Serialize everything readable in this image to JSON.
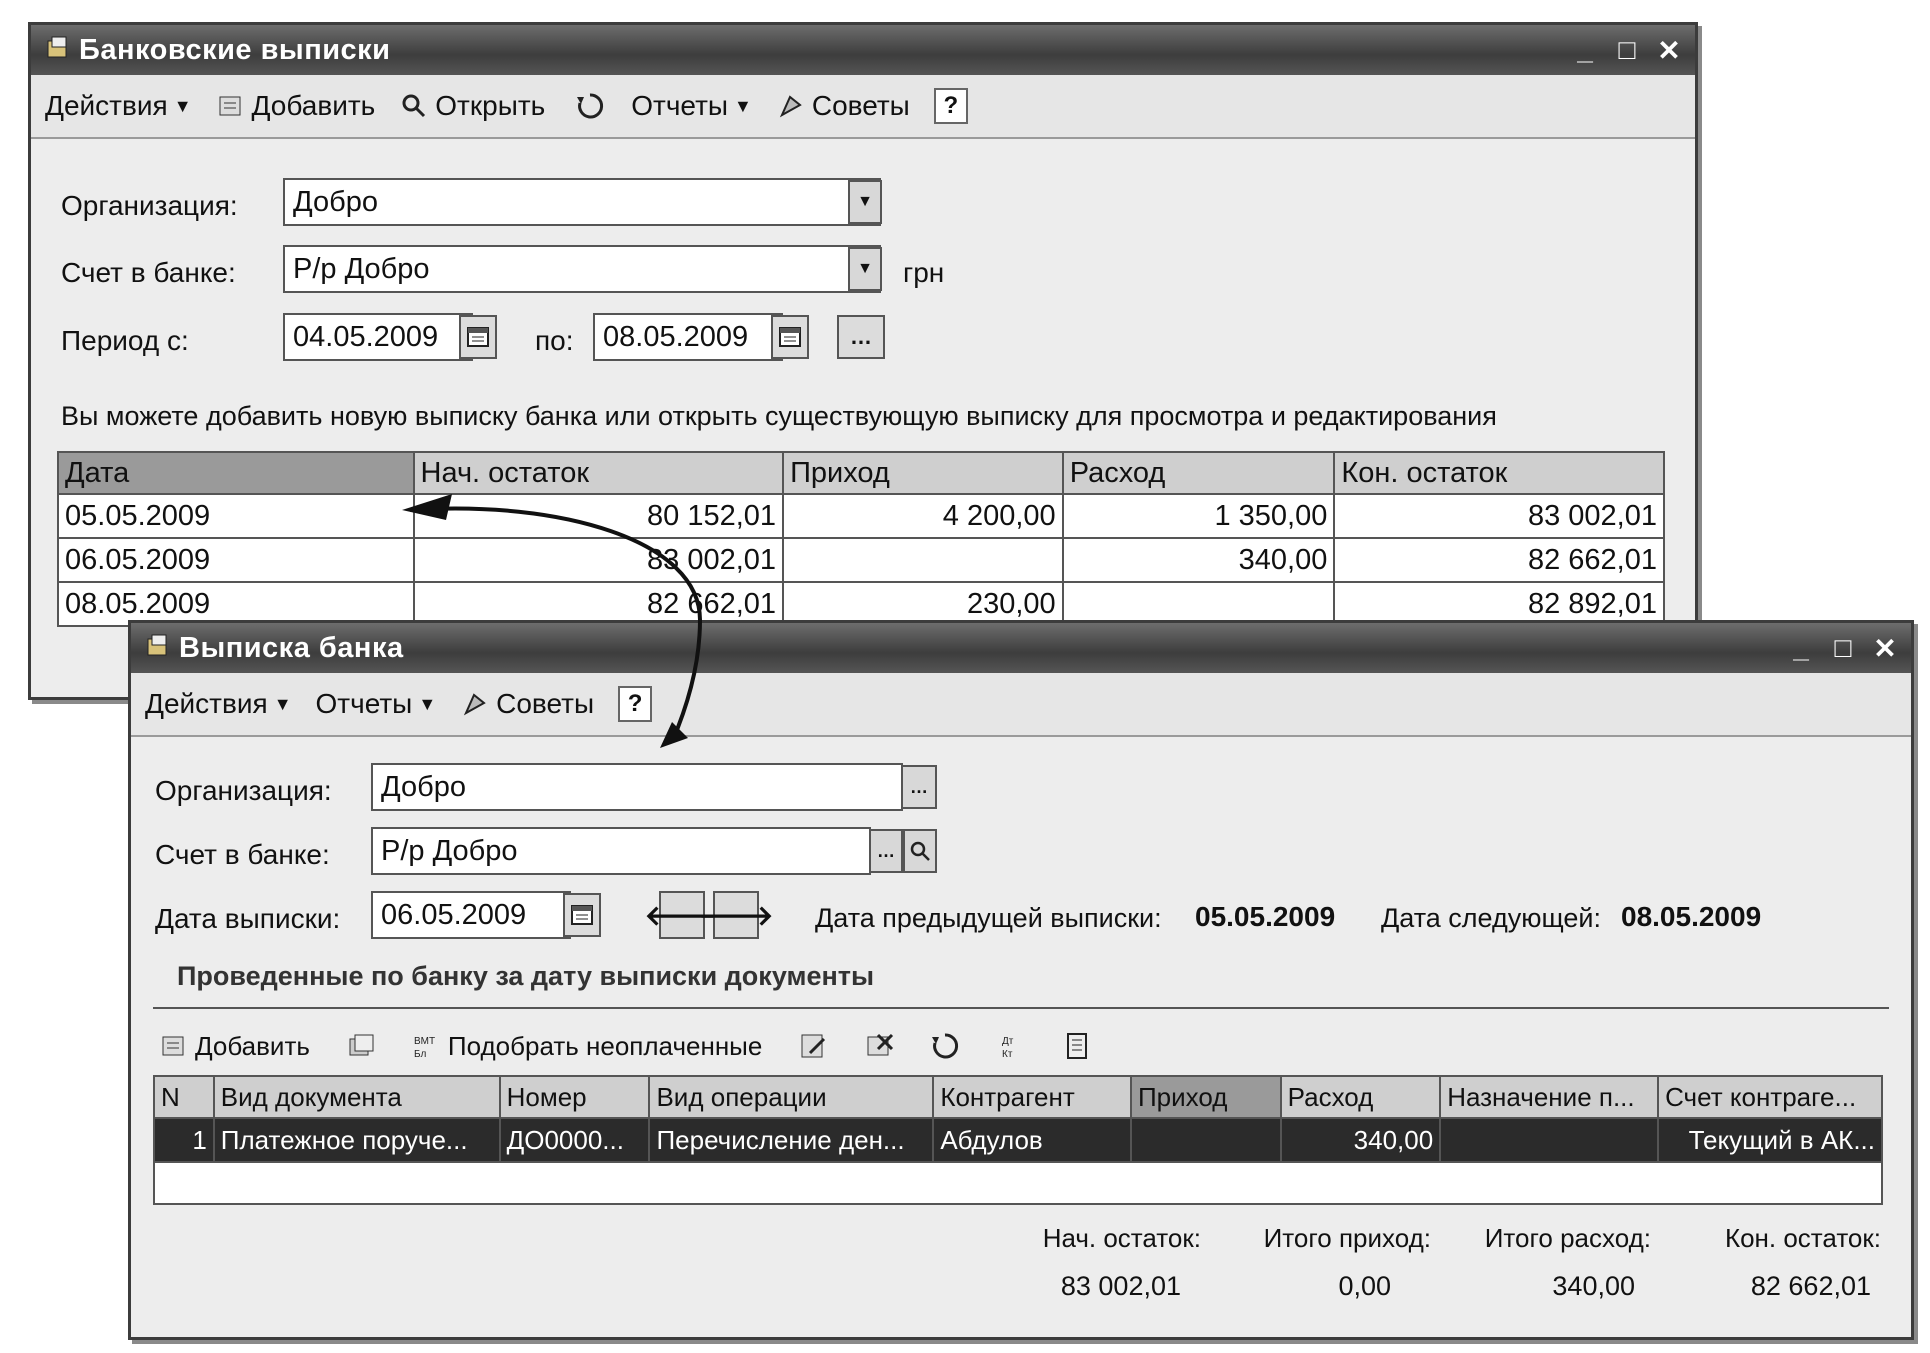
{
  "list_window": {
    "title": "Банковские выписки",
    "toolbar": {
      "actions": "Действия",
      "add": "Добавить",
      "open": "Открыть",
      "reports": "Отчеты",
      "tips": "Советы",
      "help": "?"
    },
    "org_label": "Организация:",
    "org_value": "Добро",
    "account_label": "Счет в банке:",
    "account_value": "Р/р Добро",
    "currency": "грн",
    "period_label": "Период с:",
    "period_from": "04.05.2009",
    "period_to_label": "по:",
    "period_to": "08.05.2009",
    "hint": "Вы можете добавить новую выписку банка или открыть существующую выписку для просмотра и редактирования",
    "table": {
      "columns": [
        "Дата",
        "Нач. остаток",
        "Приход",
        "Расход",
        "Кон. остаток"
      ],
      "rows": [
        [
          "05.05.2009",
          "80 152,01",
          "4 200,00",
          "1 350,00",
          "83 002,01"
        ],
        [
          "06.05.2009",
          "83 002,01",
          "",
          "340,00",
          "82 662,01"
        ],
        [
          "08.05.2009",
          "82 662,01",
          "230,00",
          "",
          "82 892,01"
        ]
      ]
    }
  },
  "statement_window": {
    "title": "Выписка банка",
    "toolbar": {
      "actions": "Действия",
      "reports": "Отчеты",
      "tips": "Советы",
      "help": "?"
    },
    "org_label": "Организация:",
    "org_value": "Добро",
    "account_label": "Счет в банке:",
    "account_value": "Р/р Добро",
    "date_label": "Дата выписки:",
    "date_value": "06.05.2009",
    "prev_label": "Дата предыдущей выписки:",
    "prev_value": "05.05.2009",
    "next_label": "Дата следующей:",
    "next_value": "08.05.2009",
    "section_title": "Проведенные по банку за дату выписки документы",
    "doc_toolbar": {
      "add": "Добавить",
      "pick_unpaid": "Подобрать неоплаченные"
    },
    "table": {
      "columns": [
        "N",
        "Вид документа",
        "Номер",
        "Вид операции",
        "Контрагент",
        "Приход",
        "Расход",
        "Назначение п...",
        "Счет контраге..."
      ],
      "rows": [
        [
          "1",
          "Платежное поруче...",
          "ДО0000...",
          "Перечисление ден...",
          "Абдулов",
          "",
          "340,00",
          "",
          "Текущий в АК..."
        ]
      ]
    },
    "totals": {
      "start_label": "Нач. остаток:",
      "start_value": "83 002,01",
      "in_label": "Итого приход:",
      "in_value": "0,00",
      "out_label": "Итого расход:",
      "out_value": "340,00",
      "end_label": "Кон. остаток:",
      "end_value": "82 662,01"
    }
  }
}
